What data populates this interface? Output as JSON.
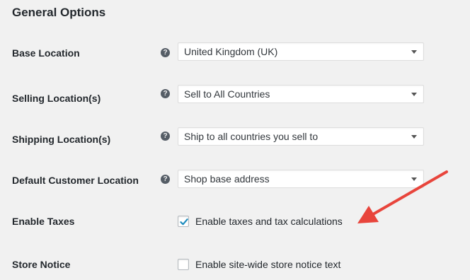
{
  "section_title": "General Options",
  "fields": {
    "base_location": {
      "label": "Base Location",
      "value": "United Kingdom (UK)"
    },
    "selling_locations": {
      "label": "Selling Location(s)",
      "value": "Sell to All Countries"
    },
    "shipping_locations": {
      "label": "Shipping Location(s)",
      "value": "Ship to all countries you sell to"
    },
    "default_customer_location": {
      "label": "Default Customer Location",
      "value": "Shop base address"
    },
    "enable_taxes": {
      "label": "Enable Taxes",
      "checkbox_label": "Enable taxes and tax calculations",
      "checked": true
    },
    "store_notice": {
      "label": "Store Notice",
      "checkbox_label": "Enable site-wide store notice text",
      "checked": false
    }
  },
  "help_icon": "?",
  "colors": {
    "background": "#f1f1f1",
    "checkmark": "#1e8cbe",
    "annotation_arrow": "#e8453c"
  }
}
